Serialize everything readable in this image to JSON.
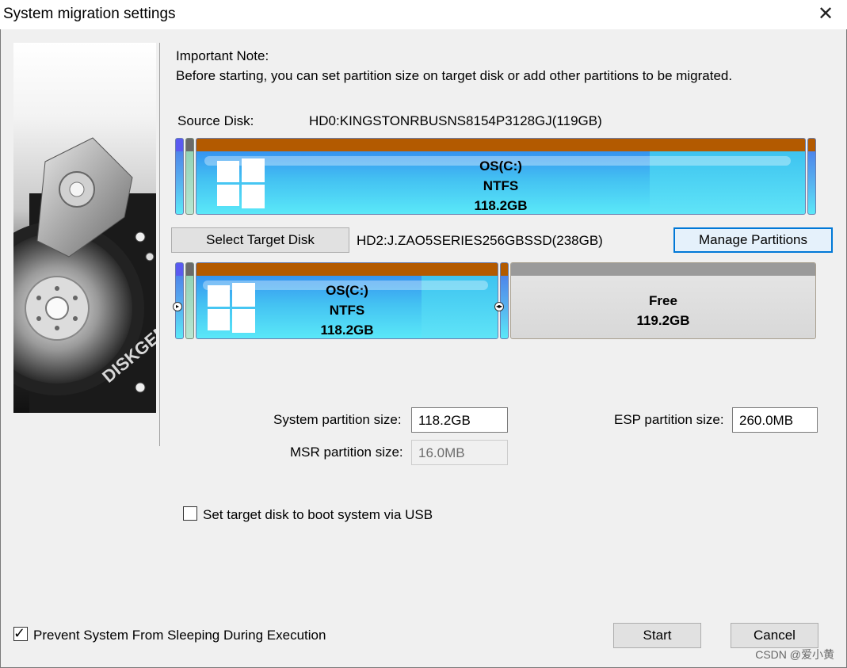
{
  "window": {
    "title": "System migration settings",
    "close_glyph": "✕"
  },
  "banner": {
    "brand": "DISKGENIUS"
  },
  "note": {
    "heading": "Important Note:",
    "body": "Before starting, you can set partition size on target disk or add other partitions to be migrated."
  },
  "source": {
    "label": "Source Disk:",
    "disk": "HD0:KINGSTONRBUSNS8154P3128GJ(119GB)",
    "partition": {
      "name": "OS(C:)",
      "fs": "NTFS",
      "size": "118.2GB"
    }
  },
  "target": {
    "select_button": "Select Target Disk",
    "disk": "HD2:J.ZAO5SERIES256GBSSD(238GB)",
    "manage_button": "Manage Partitions",
    "partition": {
      "name": "OS(C:)",
      "fs": "NTFS",
      "size": "118.2GB"
    },
    "free": {
      "name": "Free",
      "size": "119.2GB"
    }
  },
  "sizes": {
    "system_label": "System partition size:",
    "system_value": "118.2GB",
    "msr_label": "MSR partition size:",
    "msr_value": "16.0MB",
    "esp_label": "ESP partition size:",
    "esp_value": "260.0MB"
  },
  "usb_boot": {
    "label": "Set target disk to boot system via USB",
    "checked": false
  },
  "prevent_sleep": {
    "label": "Prevent System From Sleeping During Execution",
    "checked": true
  },
  "buttons": {
    "start": "Start",
    "cancel": "Cancel"
  },
  "watermark": "CSDN @爱小黄",
  "colors": {
    "partition_cap": "#b35a00",
    "partition_blue": "#44c2f2",
    "focus_border": "#0078d7"
  }
}
